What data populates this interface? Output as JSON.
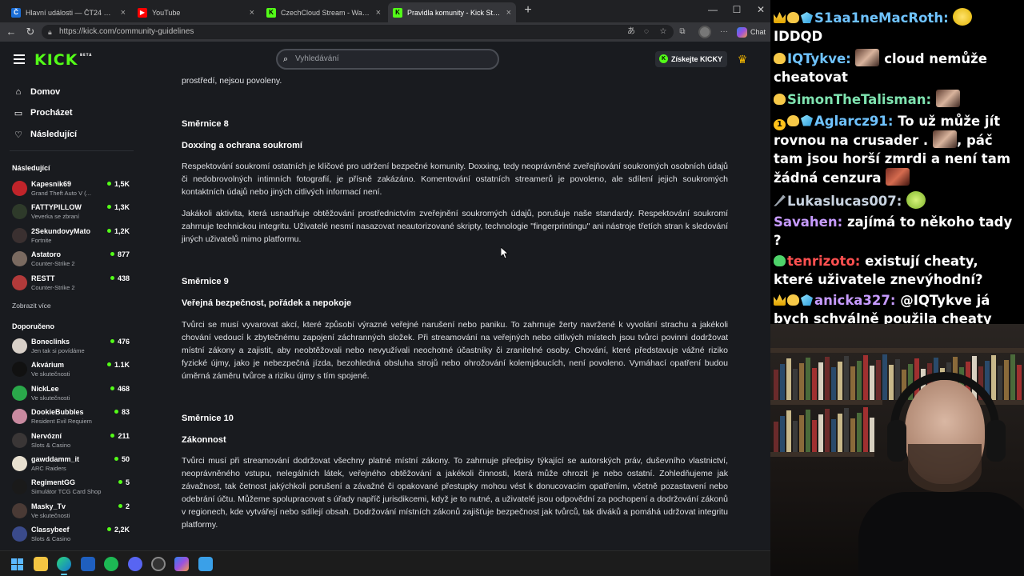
{
  "browser": {
    "tabs": [
      {
        "label": "Hlavní události — ČT24 — Česká t",
        "fav": "ČT",
        "color": "#1b6fd8"
      },
      {
        "label": "YouTube",
        "fav": "▶",
        "color": "#ff0000"
      },
      {
        "label": "CzechCloud Stream - Watch Live o",
        "fav": "K",
        "color": "#53fc18"
      },
      {
        "label": "Pravidla komunity - Kick Streaming",
        "fav": "K",
        "color": "#53fc18"
      }
    ],
    "url": "https://kick.com/community-guidelines",
    "chat_label": "Chat"
  },
  "kick": {
    "logo": "KICK",
    "logo_tag": "BETA",
    "search_placeholder": "Vyhledávání",
    "get_kicks": "Získejte KICKY",
    "nav": [
      {
        "label": "Domov",
        "icon": "home-icon"
      },
      {
        "label": "Procházet",
        "icon": "browse-icon"
      },
      {
        "label": "Následující",
        "icon": "heart-icon"
      }
    ],
    "following_title": "Následující",
    "following": [
      {
        "name": "Kapesnik69",
        "game": "Grand Theft Auto V (...",
        "count": "1,5K",
        "color": "#c0242a"
      },
      {
        "name": "FATTYPILLOW",
        "game": "Veverka se zbraní",
        "count": "1,3K",
        "color": "#2e3a2a"
      },
      {
        "name": "2SekundovyMato",
        "game": "Fortnite",
        "count": "1,2K",
        "color": "#3a3030"
      },
      {
        "name": "Astatoro",
        "game": "Counter-Strike 2",
        "count": "877",
        "color": "#7a6a60"
      },
      {
        "name": "RESTT",
        "game": "Counter-Strike 2",
        "count": "438",
        "color": "#b23a3a"
      }
    ],
    "show_more": "Zobrazit více",
    "recommended_title": "Doporučeno",
    "recommended": [
      {
        "name": "Boneclinks",
        "game": "Jen tak si povídáme",
        "count": "476",
        "color": "#d8d0c8"
      },
      {
        "name": "Akvárium",
        "game": "Ve skutečnosti",
        "count": "1.1K",
        "color": "#111111"
      },
      {
        "name": "NickLee",
        "game": "Ve skutečnosti",
        "count": "468",
        "color": "#2aa84a"
      },
      {
        "name": "DookieBubbles",
        "game": "Resident Evil Requiem",
        "count": "83",
        "color": "#c98aa0"
      },
      {
        "name": "Nervózní",
        "game": "Slots & Casino",
        "count": "211",
        "color": "#3a3636"
      },
      {
        "name": "gawddamm_it",
        "game": "ARC Raiders",
        "count": "50",
        "color": "#e8e0d0"
      },
      {
        "name": "RegimentGG",
        "game": "Simulátor TCG Card Shop",
        "count": "5",
        "color": "#1a1a1a"
      },
      {
        "name": "Masky_Tv",
        "game": "Ve skutečnosti",
        "count": "2",
        "color": "#4a3a35"
      },
      {
        "name": "Classybeef",
        "game": "Slots & Casino",
        "count": "2,2K",
        "color": "#3a4a8a"
      }
    ],
    "content": {
      "intro_tail": "prostředí, nejsou povoleny.",
      "s8_title": "Směrnice 8",
      "s8_sub": "Doxxing a ochrana soukromí",
      "s8_p1": "Respektování soukromí ostatních je klíčové pro udržení bezpečné komunity. Doxxing, tedy neoprávněné zveřejňování soukromých osobních údajů či nedobrovolných intimních fotografií, je přísně zakázáno. Komentování ostatních streamerů je povoleno, ale sdílení jejich soukromých kontaktních údajů nebo jiných citlivých informací není.",
      "s8_p2": "Jakákoli aktivita, která usnadňuje obtěžování prostřednictvím zveřejnění soukromých údajů, porušuje naše standardy. Respektování soukromí zahrnuje technickou integritu. Uživatelé nesmí nasazovat neautorizované skripty, technologie \"fingerprintingu\" ani nástroje třetích stran k sledování jiných uživatelů mimo platformu.",
      "s9_title": "Směrnice 9",
      "s9_sub": "Veřejná bezpečnost, pořádek a nepokoje",
      "s9_p1": "Tvůrci se musí vyvarovat akcí, které způsobí výrazné veřejné narušení nebo paniku. To zahrnuje žerty navržené k vyvolání strachu a jakékoli chování vedoucí k zbytečnému zapojení záchranných složek. Při streamování na veřejných nebo citlivých místech jsou tvůrci povinni dodržovat místní zákony a zajistit, aby neobtěžovali nebo nevyužívali neochotné účastníky či zranitelné osoby. Chování, které představuje vážné riziko fyzické újmy, jako je nebezpečná jízda, bezohledná obsluha strojů nebo ohrožování kolemjdoucích, není povoleno. Vymáhací opatření budou úměrná záměru tvůrce a riziku újmy s tím spojené.",
      "s10_title": "Směrnice 10",
      "s10_sub": "Zákonnost",
      "s10_p1": "Tvůrci musí při streamování dodržovat všechny platné místní zákony. To zahrnuje předpisy týkající se autorských práv, duševního vlastnictví, neoprávněného vstupu, nelegálních látek, veřejného obtěžování a jakékoli činnosti, která může ohrozit je nebo ostatní. Zohledňujeme jak závažnost, tak četnost jakýchkoli porušení a závažné či opakované přestupky mohou vést k donucovacím opatřením, včetně pozastavení nebo odebrání účtu. Můžeme spolupracovat s úřady napříč jurisdikcemi, když je to nutné, a uživatelé jsou odpovědní za pochopení a dodržování zákonů v regionech, kde vytvářejí nebo sdílejí obsah. Dodržování místních zákonů zajišťuje bezpečnost jak tvůrců, tak diváků a pomáhá udržovat integritu platformy."
    }
  },
  "stream_chat": [
    {
      "badges": [
        "crown",
        "hand",
        "gem"
      ],
      "user": "S1aa1neMacRoth",
      "color": "#6fc3ff",
      "emote_before": "yellow",
      "text": " IDDQD"
    },
    {
      "badges": [
        "hand"
      ],
      "user": "IQTykve",
      "color": "#6fc3ff",
      "emote_before": "face",
      "text": " cloud nemůže cheatovat"
    },
    {
      "badges": [
        "hand"
      ],
      "user": "SimonTheTalisman",
      "color": "#7fe3b0",
      "emote_before": "face",
      "text": ""
    },
    {
      "badges": [
        "sub1",
        "hand",
        "gem"
      ],
      "user": "Aglarcz91",
      "color": "#6fc3ff",
      "text": " To už může jít rovnou na crusader . ",
      "emote_mid": "face",
      "text2": ", páč tam jsou horší zmrdi a není tam žádná cenzura",
      "emote_end": "red"
    },
    {
      "badges": [
        "sword"
      ],
      "user": "Lukaslucas007",
      "color": "#c8d3e0",
      "emote_before": "green",
      "text": ""
    },
    {
      "badges": [],
      "user": "Savahen",
      "color": "#c79bff",
      "text": " zajímá to někoho tady ?"
    },
    {
      "badges": [
        "greenhand"
      ],
      "user": "tenrizoto",
      "color": "#ff5050",
      "text": " existují cheaty, které uživatele znevýhodní?"
    },
    {
      "badges": [
        "crown",
        "hand",
        "gem"
      ],
      "user": "anicka327",
      "color": "#c79bff",
      "text": " @IQTykve já bych schválně použila cheaty"
    }
  ]
}
